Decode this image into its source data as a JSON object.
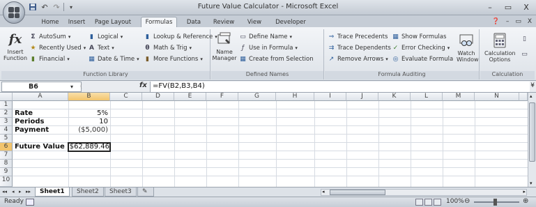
{
  "window": {
    "title": "Future Value Calculator - Microsoft Excel",
    "controls": {
      "minimize": "–",
      "restore": "▭",
      "close": "X"
    }
  },
  "tabs": [
    "Home",
    "Insert",
    "Page Layout",
    "Formulas",
    "Data",
    "Review",
    "View",
    "Developer"
  ],
  "active_tab": "Formulas",
  "ribbon": {
    "function_library": {
      "label": "Function Library",
      "insert_function": "Insert Function",
      "autosum": "AutoSum",
      "recently_used": "Recently Used",
      "financial": "Financial",
      "logical": "Logical",
      "text": "Text",
      "date_time": "Date & Time",
      "lookup_reference": "Lookup & Reference",
      "math_trig": "Math & Trig",
      "more_functions": "More Functions"
    },
    "defined_names": {
      "label": "Defined Names",
      "name_manager": "Name Manager",
      "define_name": "Define Name",
      "use_in_formula": "Use in Formula",
      "create_from_selection": "Create from Selection"
    },
    "formula_auditing": {
      "label": "Formula Auditing",
      "trace_precedents": "Trace Precedents",
      "trace_dependents": "Trace Dependents",
      "remove_arrows": "Remove Arrows",
      "show_formulas": "Show Formulas",
      "error_checking": "Error Checking",
      "evaluate_formula": "Evaluate Formula",
      "watch_window": "Watch Window"
    },
    "calculation": {
      "label": "Calculation",
      "calculation_options": "Calculation Options"
    }
  },
  "formula_bar": {
    "name_box": "B6",
    "formula": "=FV(B2,B3,B4)"
  },
  "columns": [
    "A",
    "B",
    "C",
    "D",
    "E",
    "F",
    "G",
    "H",
    "I",
    "J",
    "K",
    "L",
    "M",
    "N"
  ],
  "rows": [
    "1",
    "2",
    "3",
    "4",
    "5",
    "6",
    "7",
    "8",
    "9",
    "10"
  ],
  "cells": {
    "A2": "Rate",
    "B2": "5%",
    "A3": "Periods",
    "B3": "10",
    "A4": "Payment",
    "B4": "($5,000)",
    "A6": "Future Value",
    "B6": "$62,889.46"
  },
  "sheets": [
    "Sheet1",
    "Sheet2",
    "Sheet3"
  ],
  "active_sheet": "Sheet1",
  "status": {
    "mode": "Ready",
    "zoom": "100%"
  }
}
